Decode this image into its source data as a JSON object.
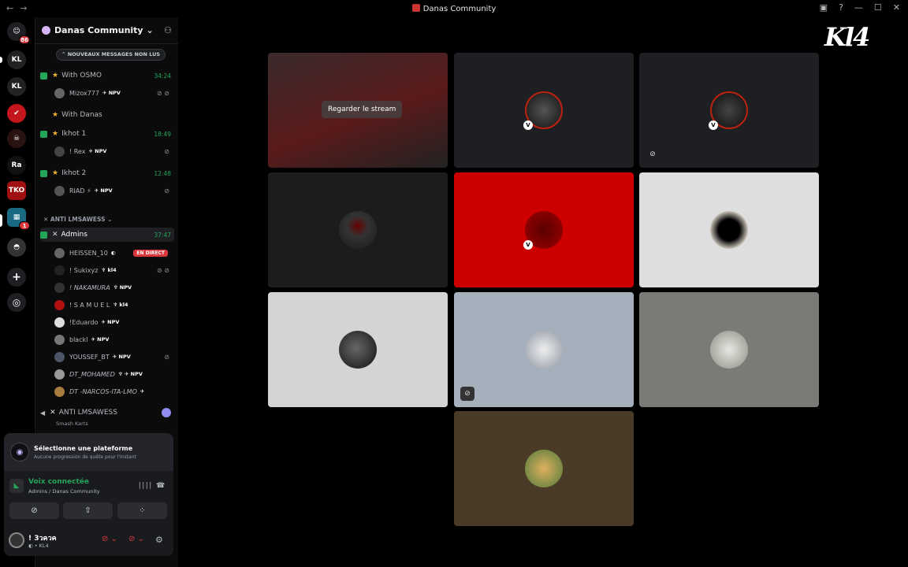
{
  "window": {
    "title": "Danas Community",
    "nav_back": "←",
    "nav_forward": "→",
    "controls": [
      "▣",
      "?",
      "—",
      "☐",
      "✕"
    ]
  },
  "servers": [
    {
      "label": "☺",
      "badge": "86",
      "color": "#1e1f22"
    },
    {
      "label": "KL",
      "color": "#222"
    },
    {
      "label": "KL",
      "color": "#222"
    },
    {
      "label": "✔",
      "color": "#c4161c"
    },
    {
      "label": "☠",
      "color": "#2a1210"
    },
    {
      "label": "Ra",
      "color": "#111"
    },
    {
      "label": "TKO",
      "color": "#a01010"
    },
    {
      "label": "▦",
      "badge": "1",
      "color": "#1a6a84"
    },
    {
      "label": "◓",
      "color": "#333"
    },
    {
      "label": "+",
      "color": "#1e1f22"
    },
    {
      "label": "◎",
      "color": "#1e1f22"
    }
  ],
  "guild": {
    "name": "Danas Community",
    "chevron": "⌄",
    "add_icon": "⚇",
    "new_messages": "⌃ NOUVEAUX MESSAGES NON LUS"
  },
  "channels": {
    "with_osmo": {
      "name": "With OSMO",
      "time": "34:24"
    },
    "with_osmo_member": {
      "name": "Mizox777",
      "tag": "✈ NPV",
      "icons": "⊘ ⊘"
    },
    "with_danas": {
      "name": "With Danas"
    },
    "ikhot1": {
      "name": "Ikhot 1",
      "time": "18:49"
    },
    "ikhot1_member": {
      "name": "! Rex",
      "tag": "✈ NPV",
      "icons": "⊘"
    },
    "ikhot2": {
      "name": "Ikhot 2",
      "time": "12:48"
    },
    "ikhot2_member": {
      "name": "RIAD ⚡",
      "tag": "✈ NPV",
      "icons": "⊘"
    },
    "category": "✕ ANTI LMSAWESS ⌄",
    "admins": {
      "name": "Admins",
      "time": "37:47"
    },
    "admins_members": [
      {
        "name": "HEISSEN_10",
        "tag": "◐",
        "live": "EN DIRECT",
        "color": "#666"
      },
      {
        "name": "! Sukixyz",
        "tag": "♆ kl4",
        "icons": "⊘ ⊘",
        "color": "#222"
      },
      {
        "name": "! NAKAMURA",
        "tag": "♆ NPV",
        "color": "#333"
      },
      {
        "name": "! S A M U E L",
        "tag": "♆ kl4",
        "color": "#b01010"
      },
      {
        "name": "!Eduardo",
        "tag": "✈ NPV",
        "color": "#ddd"
      },
      {
        "name": "blackl",
        "tag": "✈ NPV",
        "color": "#777"
      },
      {
        "name": "YOUSSEF_BT",
        "tag": "✈ NPV",
        "icons": "⊘",
        "color": "#4a5568"
      },
      {
        "name": "DT_MOHAMED",
        "tag": "♆ ✈ NPV",
        "color": "#999"
      },
      {
        "name": "DT -NARCOS-ITA-LMO",
        "tag": "✈",
        "color": "#a87c3c"
      }
    ],
    "anti": {
      "name": "ANTI LMSAWESS",
      "sub": "Smash Karts"
    }
  },
  "quest": {
    "title": "Sélectionne une plateforme",
    "subtitle": "Aucune progression de quête pour l'instant",
    "icon": "◉"
  },
  "voice": {
    "status": "Voix connectée",
    "location": "Admins / Danas Community",
    "icon": "◣",
    "wave": "∣∣∣∣",
    "hangup": "☎"
  },
  "voice_buttons": [
    "⊘",
    "⇧",
    "⁘"
  ],
  "user": {
    "name": "! 3วควค",
    "status": "◐ • KL4",
    "mic": "⊘ ⌄",
    "deafen": "⊘ ⌄",
    "settings": "⚙"
  },
  "stage": {
    "watch_stream": "Regarder le stream",
    "logo": "Kl4",
    "tiles": [
      {
        "bg": "#1a1a1a",
        "stream": true
      },
      {
        "bg": "#1e1f22",
        "avatar": "#333",
        "badge": "V"
      },
      {
        "bg": "#1e1f22",
        "avatar": "#222",
        "badge": "V",
        "muted_icon": "⊘"
      },
      {
        "bg": "#1b1c1e",
        "avatar": "#2a2a2a"
      },
      {
        "bg": "#cc0000",
        "avatar": "#7a0000",
        "badge": "V"
      },
      {
        "bg": "#dedede",
        "avatar": "#111"
      },
      {
        "bg": "#d4d4d4",
        "avatar": "#2b2b2b"
      },
      {
        "bg": "#a6b0bd",
        "avatar": "#c9ccd2",
        "muted_icon": "⊘"
      },
      {
        "bg": "#7b7a76",
        "avatar": "#c9cbc4"
      },
      {
        "bg": "#4a3a28",
        "avatar": "#c28a3d"
      }
    ]
  }
}
